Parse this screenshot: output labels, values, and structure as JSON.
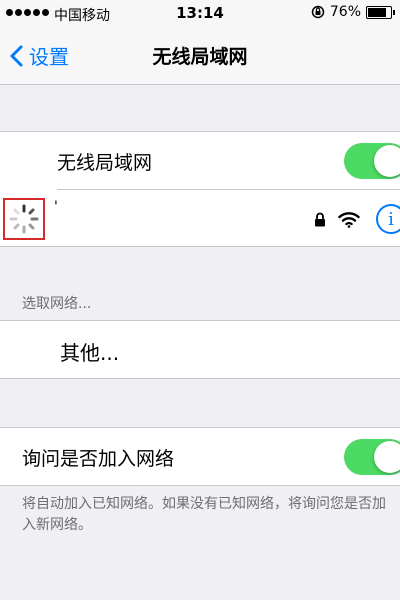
{
  "status_bar": {
    "carrier": "中国移动",
    "time": "13:14",
    "battery": "76%",
    "battery_level": 0.76
  },
  "nav": {
    "back_label": "设置",
    "title": "无线局域网"
  },
  "wifi_toggle": {
    "label": "无线局域网",
    "on": true
  },
  "connecting_network": {
    "name": "'",
    "secured": true
  },
  "choose_network": {
    "header": "选取网络...",
    "other_label": "其他..."
  },
  "ask_to_join": {
    "label": "询问是否加入网络",
    "on": true,
    "footer": "将自动加入已知网络。如果没有已知网络，将询问您是否加入新网络。"
  },
  "colors": {
    "accent": "#007aff",
    "toggle_on": "#4cd964",
    "highlight_box": "#d42a2a",
    "background": "#efeff4"
  },
  "icons": [
    "back-chevron-icon",
    "lock-icon",
    "wifi-icon",
    "info-icon",
    "loading-spinner-icon",
    "orientation-lock-icon",
    "battery-icon"
  ]
}
